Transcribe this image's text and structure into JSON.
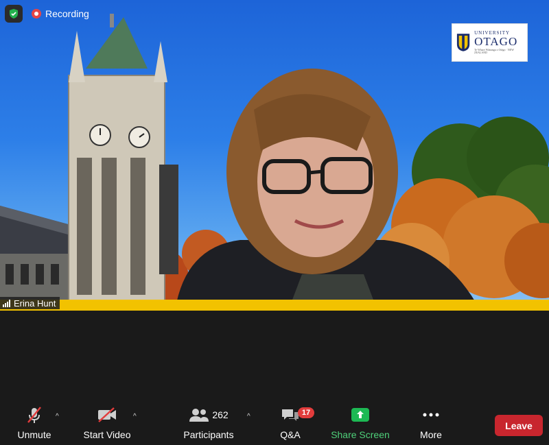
{
  "recording": {
    "label": "Recording"
  },
  "participant": {
    "name": "Erina Hunt"
  },
  "logo": {
    "small": "UNIVERSITY",
    "big": "OTAGO",
    "sub": "Te Whare Wānanga o Otāgo · NEW ZEALAND"
  },
  "toolbar": {
    "unmute": "Unmute",
    "start_video": "Start Video",
    "participants": "Participants",
    "participants_count": "262",
    "qa": "Q&A",
    "qa_badge": "17",
    "share_screen": "Share Screen",
    "more": "More",
    "leave": "Leave"
  },
  "colors": {
    "share_green": "#1db954",
    "leave_red": "#c8262e",
    "badge_red": "#e23c3c",
    "name_bar_yellow": "#f2c200"
  }
}
